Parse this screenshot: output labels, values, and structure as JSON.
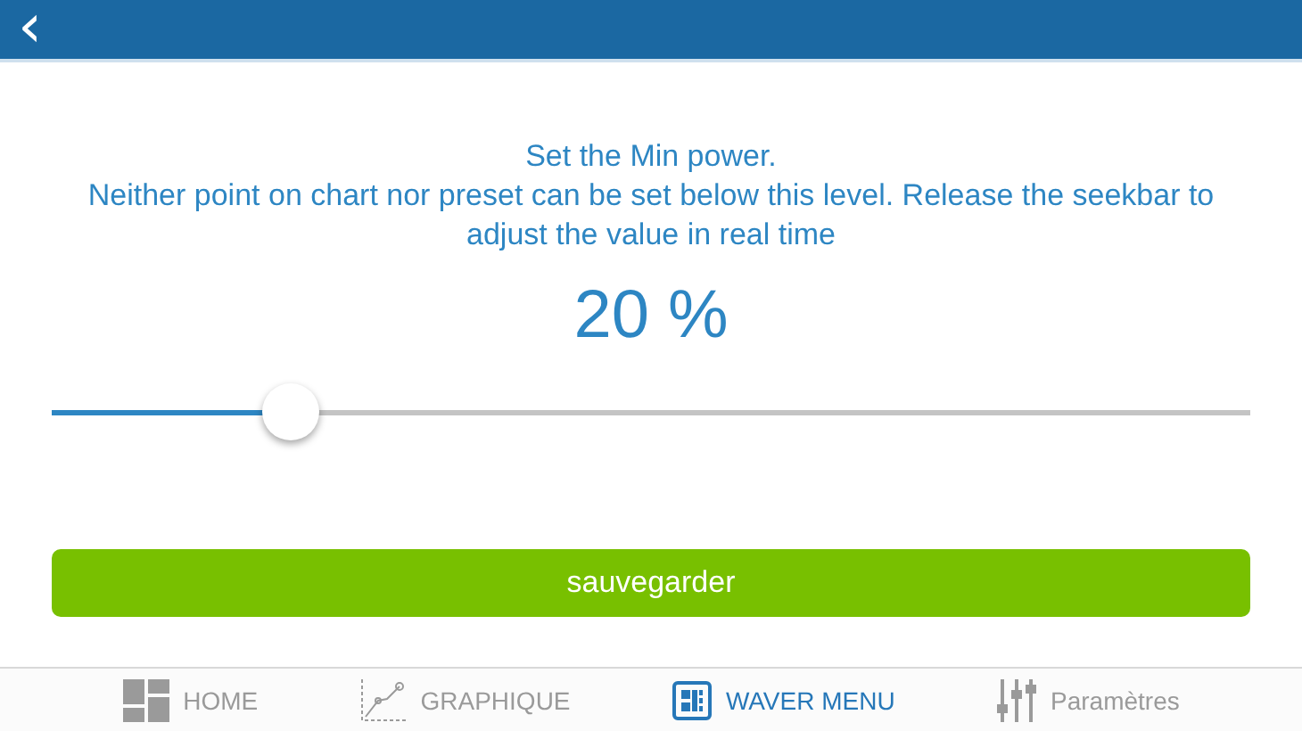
{
  "header": {
    "back_button": "‹"
  },
  "instructions": [
    "Set the Min power.",
    "Neither point on chart nor preset can be set below this level. Release the seekbar to adjust the value in real time"
  ],
  "power": {
    "reading": "20 %",
    "level": 0.2
  },
  "save_button": "sauvegarder",
  "nav": [
    {
      "label": "HOME",
      "kind": "home",
      "selected": false
    },
    {
      "label": "GRAPHIQUE",
      "kind": "chart",
      "selected": false
    },
    {
      "label": "WAVER MENU",
      "kind": "menu",
      "selected": true
    },
    {
      "label": "Paramètres",
      "kind": "settings",
      "selected": false
    }
  ]
}
